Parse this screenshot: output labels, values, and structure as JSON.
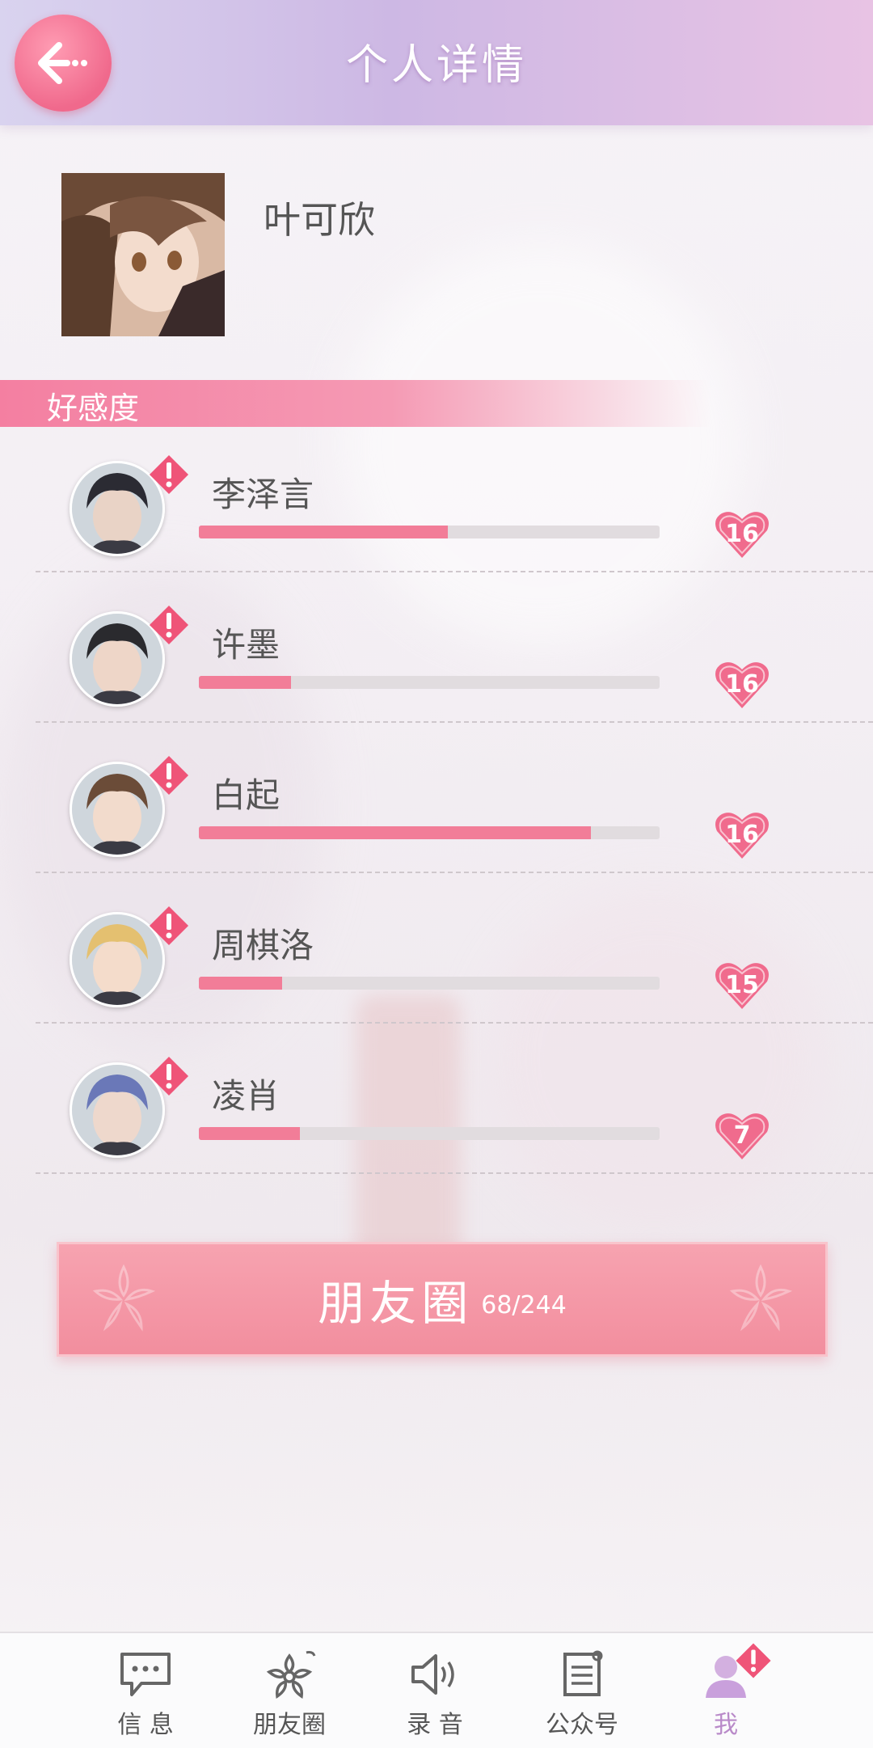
{
  "header": {
    "title": "个人详情",
    "back_icon": "back-arrow-icon"
  },
  "profile": {
    "name": "叶可欣"
  },
  "affection_section": {
    "label": "好感度"
  },
  "characters": [
    {
      "name": "李泽言",
      "level": "16",
      "progress": 0.54
    },
    {
      "name": "许墨",
      "level": "16",
      "progress": 0.2
    },
    {
      "name": "白起",
      "level": "16",
      "progress": 0.85
    },
    {
      "name": "周棋洛",
      "level": "15",
      "progress": 0.18
    },
    {
      "name": "凌肖",
      "level": "7",
      "progress": 0.22
    }
  ],
  "moments_button": {
    "label": "朋友圈",
    "count": "68/244"
  },
  "tabbar": {
    "items": [
      {
        "label": "信 息",
        "icon": "chat-bubble-icon"
      },
      {
        "label": "朋友圈",
        "icon": "flower-icon"
      },
      {
        "label": "录 音",
        "icon": "speaker-icon"
      },
      {
        "label": "公众号",
        "icon": "newspaper-icon"
      },
      {
        "label": "我",
        "icon": "person-icon"
      }
    ]
  },
  "colors": {
    "accent": "#f27d98",
    "header_start": "#d9d3ef",
    "header_end": "#e8c3e4",
    "active_tab": "#b98ac9"
  }
}
